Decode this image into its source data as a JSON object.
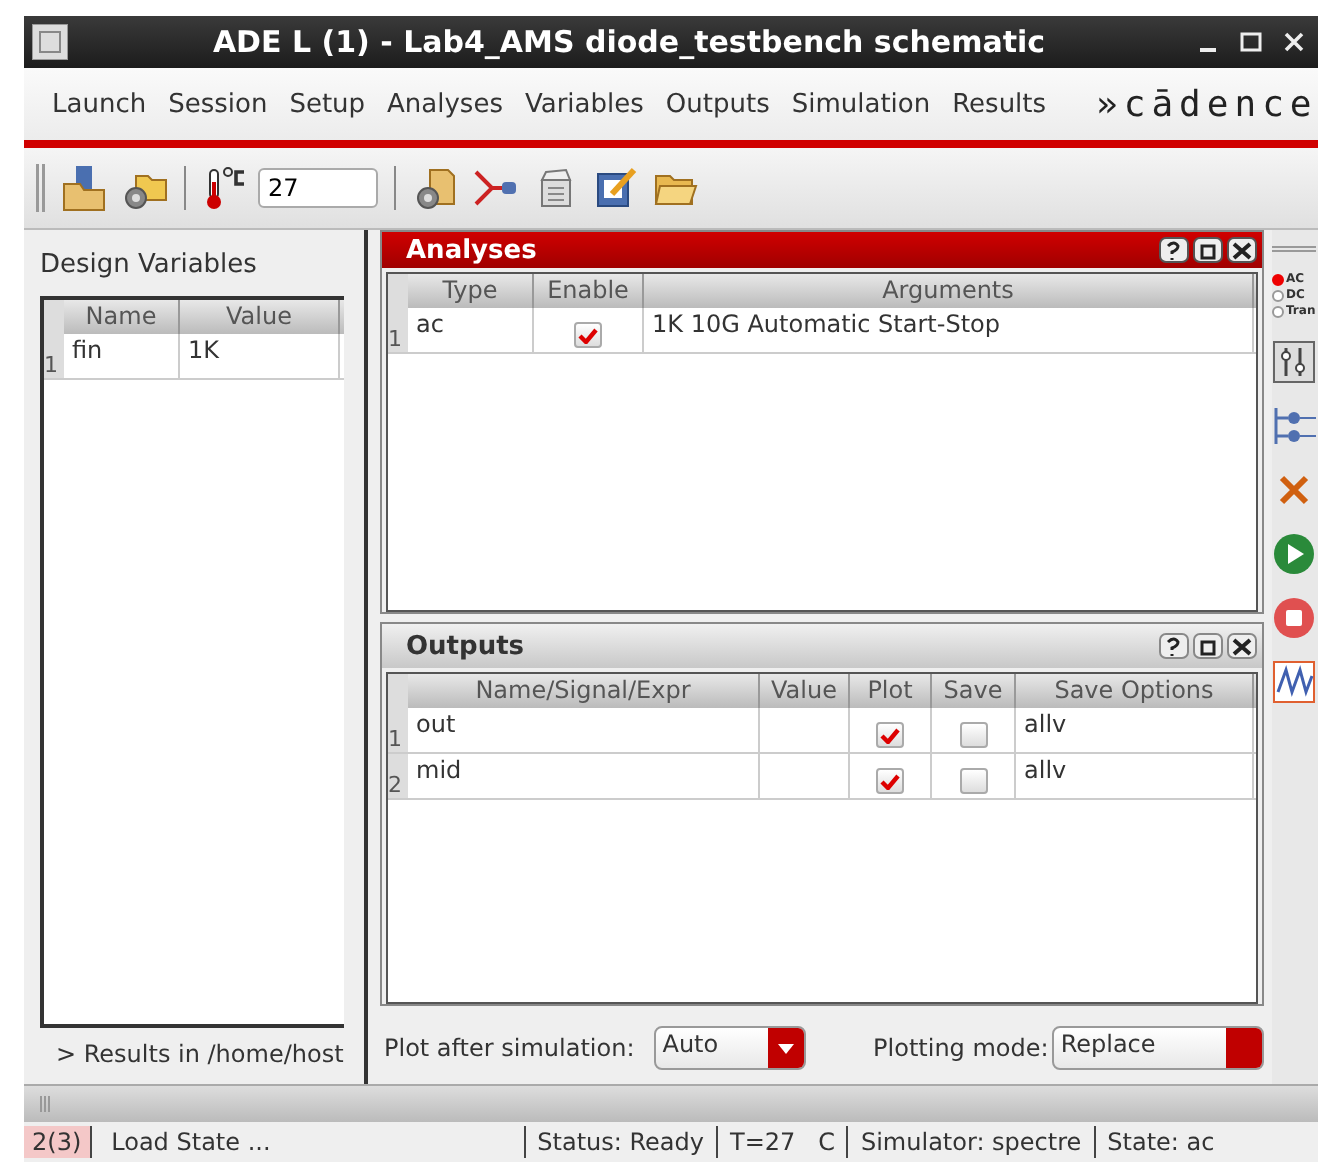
{
  "window": {
    "title": "ADE L (1) - Lab4_AMS diode_testbench schematic"
  },
  "menu": [
    {
      "label": "Launch"
    },
    {
      "label": "Session"
    },
    {
      "label": "Setup"
    },
    {
      "label": "Analyses"
    },
    {
      "label": "Variables"
    },
    {
      "label": "Outputs"
    },
    {
      "label": "Simulation"
    },
    {
      "label": "Results"
    }
  ],
  "logo": "»cādence",
  "toolbar": {
    "temperature": "27"
  },
  "design_variables": {
    "title": "Design Variables",
    "columns": [
      "Name",
      "Value"
    ],
    "rows": [
      {
        "index": "1",
        "cells": [
          "fin",
          "1K"
        ]
      }
    ],
    "footer": "> Results in /home/host"
  },
  "analyses": {
    "title": "Analyses",
    "columns": [
      "Type",
      "Enable",
      "Arguments"
    ],
    "rows": [
      {
        "index": "1",
        "type": "ac",
        "enabled": true,
        "arguments": "1K 10G Automatic Start-Stop"
      }
    ]
  },
  "outputs": {
    "title": "Outputs",
    "columns": [
      "Name/Signal/Expr",
      "Value",
      "Plot",
      "Save",
      "Save Options"
    ],
    "rows": [
      {
        "index": "1",
        "name": "out",
        "plot": true,
        "save": false,
        "save_options": "allv"
      },
      {
        "index": "2",
        "name": "mid",
        "plot": true,
        "save": false,
        "save_options": "allv"
      }
    ]
  },
  "plot_after_simulation": {
    "label": "Plot after simulation:",
    "value": "Auto"
  },
  "plotting_mode": {
    "label": "Plotting mode:",
    "value": "Replace"
  },
  "side_toolbar": {
    "analysis_types": [
      {
        "label": "AC",
        "selected": true
      },
      {
        "label": "DC",
        "selected": false
      },
      {
        "label": "Tran",
        "selected": false
      }
    ]
  },
  "status_bar": {
    "count": "2(3)",
    "message": "Load State ...",
    "status": "Status: Ready",
    "temperature": "T=27   C",
    "simulator": "Simulator: spectre",
    "state": "State: ac"
  }
}
